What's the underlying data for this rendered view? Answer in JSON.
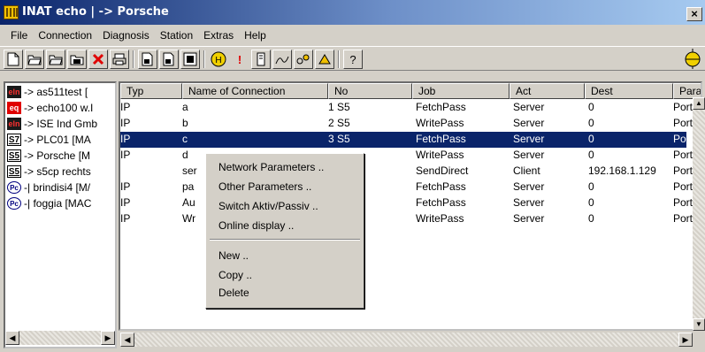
{
  "window": {
    "title": "INAT echo | -> Porsche",
    "close_label": "×"
  },
  "menu": [
    "File",
    "Connection",
    "Diagnosis",
    "Station",
    "Extras",
    "Help"
  ],
  "toolbar": {
    "icons": [
      "new-document-icon",
      "open-folder-icon",
      "open-folder-2-icon",
      "open-folder-3-icon",
      "delete-icon",
      "print-icon",
      "settings-1-icon",
      "settings-2-icon",
      "settings-3-icon",
      "online-icon",
      "alert-icon",
      "station-icon",
      "diag-1-icon",
      "diag-2-icon",
      "diag-3-icon",
      "help-icon"
    ],
    "alert_label": "!",
    "help_label": "?"
  },
  "tree": [
    {
      "badge": "eln",
      "label": "-> as511test  ["
    },
    {
      "badge": "eq",
      "label": "-> echo100 w.I"
    },
    {
      "badge": "eln",
      "label": "-> ISE Ind Gmb"
    },
    {
      "badge": "S7",
      "label": "-> PLC01  [MA"
    },
    {
      "badge": "S5",
      "label": "-> Porsche  [M"
    },
    {
      "badge": "S5",
      "label": "-> s5cp rechts"
    },
    {
      "badge": "Pc",
      "label": "-| brindisi4  [M/"
    },
    {
      "badge": "Pc",
      "label": "-| foggia  [MAC"
    }
  ],
  "list": {
    "columns": [
      "Typ",
      "Name of Connection",
      "No",
      "Job",
      "Act",
      "Dest",
      "Param"
    ],
    "rows": [
      {
        "typ": "IP",
        "name": "a",
        "no": "1 S5",
        "job": "FetchPass",
        "act": "Server",
        "dest": "0",
        "param": "Port"
      },
      {
        "typ": "IP",
        "name": "b",
        "no": "2 S5",
        "job": "WritePass",
        "act": "Server",
        "dest": "0",
        "param": "Port"
      },
      {
        "typ": "IP",
        "name": "c",
        "no": "3 S5",
        "job": "FetchPass",
        "act": "Server",
        "dest": "0",
        "param": "Port"
      },
      {
        "typ": "IP",
        "name": "d",
        "no": "",
        "job": "WritePass",
        "act": "Server",
        "dest": "0",
        "param": "Port"
      },
      {
        "typ": "",
        "name": "ser",
        "no": "",
        "job": "SendDirect",
        "act": "Client",
        "dest": "192.168.1.129",
        "param": "Port"
      },
      {
        "typ": "IP",
        "name": "pa",
        "no": "",
        "job": "FetchPass",
        "act": "Server",
        "dest": "0",
        "param": "Port"
      },
      {
        "typ": "IP",
        "name": "Au",
        "no": "",
        "job": "FetchPass",
        "act": "Server",
        "dest": "0",
        "param": "Port"
      },
      {
        "typ": "IP",
        "name": "Wr",
        "no": "",
        "job": "WritePass",
        "act": "Server",
        "dest": "0",
        "param": "Port"
      }
    ],
    "selected_row": 2
  },
  "context_menu": {
    "items": [
      "Network Parameters ..",
      "Other Parameters ..",
      "Switch Aktiv/Passiv ..",
      "Online display ..",
      "New ..",
      "Copy ..",
      "Delete"
    ]
  },
  "colors": {
    "selection": "#0a246a",
    "title_gradient_start": "#0a246a",
    "title_gradient_end": "#a6caf0"
  }
}
